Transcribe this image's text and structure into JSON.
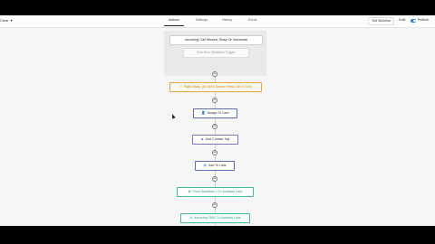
{
  "header": {
    "back_label": "Clear",
    "tabs": [
      "Actions",
      "Settings",
      "History",
      "Enroll"
    ],
    "active_tab": "Actions",
    "test_button": "Test Workflow",
    "draft_label": "Draft",
    "publish_label": "Publish"
  },
  "trigger": {
    "title": "Incoming Call Missed, Busy Or Voicemail",
    "add_trigger": "Add New Workflow Trigger"
  },
  "nodes": [
    {
      "label": "Right Away, (As SMS Doesn't Pass Like 4 Sec)",
      "icon": "clock-icon",
      "style": "orange"
    },
    {
      "label": "Assign To User",
      "icon": "user-icon",
      "style": "blue"
    },
    {
      "label": "Add Contact Tag",
      "icon": "tag-icon",
      "style": "purple"
    },
    {
      "label": "Add To Lists",
      "icon": "list-icon",
      "style": "blue"
    },
    {
      "label": "From Workflow > To Auxiliary Lists",
      "icon": "flow-icon",
      "style": "teal"
    },
    {
      "label": "Incoming SMS To Auxiliary Lists",
      "icon": "sms-icon",
      "style": "teal"
    }
  ],
  "colors": {
    "accent": "#3a7bd5",
    "wait": "#e6a23c",
    "assign": "#5d6bb8",
    "tag": "#8a6ec1",
    "goal": "#3bbf9e"
  }
}
